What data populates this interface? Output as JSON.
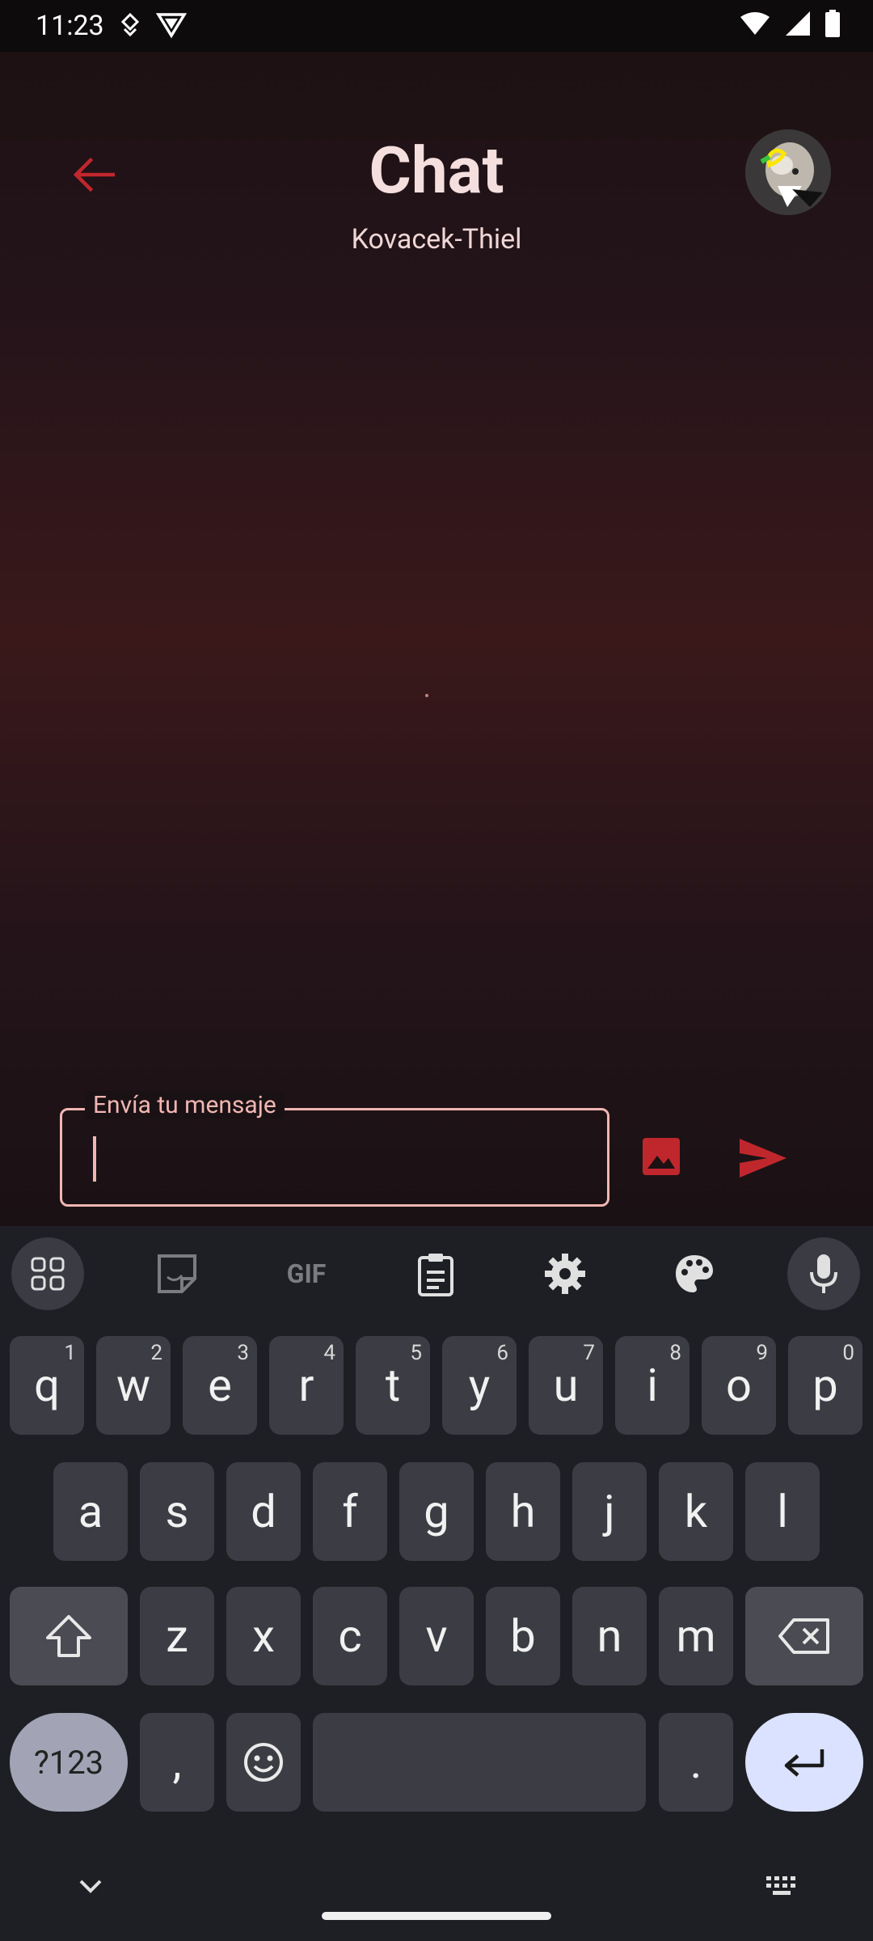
{
  "status_bar": {
    "time": "11:23"
  },
  "header": {
    "title": "Chat",
    "subtitle": "Kovacek-Thiel"
  },
  "message_input": {
    "label": "Envía tu mensaje",
    "value": ""
  },
  "keyboard": {
    "row1": [
      {
        "label": "q",
        "hint": "1"
      },
      {
        "label": "w",
        "hint": "2"
      },
      {
        "label": "e",
        "hint": "3"
      },
      {
        "label": "r",
        "hint": "4"
      },
      {
        "label": "t",
        "hint": "5"
      },
      {
        "label": "y",
        "hint": "6"
      },
      {
        "label": "u",
        "hint": "7"
      },
      {
        "label": "i",
        "hint": "8"
      },
      {
        "label": "o",
        "hint": "9"
      },
      {
        "label": "p",
        "hint": "0"
      }
    ],
    "row2": [
      "a",
      "s",
      "d",
      "f",
      "g",
      "h",
      "j",
      "k",
      "l"
    ],
    "row3": [
      "z",
      "x",
      "c",
      "v",
      "b",
      "n",
      "m"
    ],
    "numbers_label": "?123",
    "comma": ",",
    "period": ".",
    "toolbar_gif": "GIF"
  },
  "colors": {
    "accent": "#c0272d",
    "input_border": "#f1b6b2",
    "title": "#f4dede"
  }
}
